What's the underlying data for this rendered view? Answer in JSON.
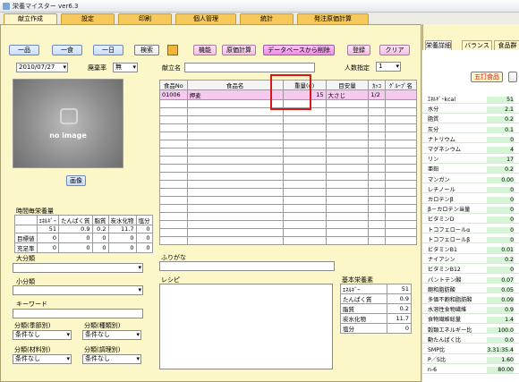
{
  "window": {
    "title": "栄養マイスター ver6.3"
  },
  "main_tabs": [
    "献立作成",
    "設定",
    "印刷",
    "個人管理",
    "統計",
    "発注原価計算"
  ],
  "meal_buttons": [
    "一品",
    "一食",
    "一日"
  ],
  "search_label": "検索",
  "toolbar": {
    "label_func": "機能",
    "cost_calc": "原価計算",
    "db_delete": "データベースから削除",
    "register": "登録",
    "clear": "クリア"
  },
  "date": "2010/07/27",
  "waste_rate": {
    "label": "廃棄率",
    "value": "無"
  },
  "menu_name_label": "献立名",
  "servings": {
    "label": "人数指定",
    "value": "1"
  },
  "photo": {
    "text": "no image",
    "button": "画像"
  },
  "food_table": {
    "headers": [
      "食品No",
      "食品名",
      "重量(g)",
      "目安量",
      "ｶｯｺ",
      "ｸﾞﾙｰﾌﾟ名"
    ],
    "rows": [
      [
        "01006",
        "押麦",
        "15",
        "大さじ",
        "1/2",
        "",
        ""
      ]
    ]
  },
  "hourly": {
    "title": "時間毎栄養量",
    "headers": [
      "",
      "ｴﾈﾙｷﾞｰ",
      "たんぱく質",
      "脂質",
      "炭水化物",
      "塩分"
    ],
    "rows": [
      [
        "",
        "51",
        "0.9",
        "0.2",
        "11.7",
        "0"
      ],
      [
        "目標値",
        "0",
        "0",
        "0",
        "0",
        "0"
      ],
      [
        "充足率",
        "0",
        "0",
        "0",
        "0",
        "0"
      ]
    ]
  },
  "left_fields": {
    "daibunrui": "大分類",
    "shobunrui": "小分類",
    "keyword": "キーワード"
  },
  "bunrui": {
    "season": {
      "label": "分類(季節別)",
      "value": "条件なし"
    },
    "kind": {
      "label": "分類(種類別)",
      "value": "条件なし"
    },
    "material": {
      "label": "分類(材料別)",
      "value": "条件なし"
    },
    "method": {
      "label": "分類(調理別)",
      "value": "条件なし"
    }
  },
  "furigana_label": "ふりがな",
  "recipe_label": "レシピ",
  "basic_nutrients": {
    "title": "基本栄養素",
    "items": [
      [
        "ｴﾈﾙｷﾞｰ",
        "51"
      ],
      [
        "たんぱく質",
        "0.9"
      ],
      [
        "脂質",
        "0.2"
      ],
      [
        "炭水化物",
        "11.7"
      ],
      [
        "塩分",
        "0"
      ]
    ]
  },
  "nutri_tabs": [
    "栄養詳細",
    "バランス",
    "食品群"
  ],
  "five_foods": "五訂食品",
  "nutrients": [
    [
      "ｴﾈﾙｷﾞｰkcal",
      "51"
    ],
    [
      "水分",
      "2.1"
    ],
    [
      "脂質",
      "0.2"
    ],
    [
      "灰分",
      "0.1"
    ],
    [
      "ナトリウム",
      "0"
    ],
    [
      "マグネシウム",
      "4"
    ],
    [
      "リン",
      "17"
    ],
    [
      "亜鉛",
      "0.2"
    ],
    [
      "マンガン",
      "0.00"
    ],
    [
      "レチノール",
      "0"
    ],
    [
      "カロテンβ",
      "0"
    ],
    [
      "β－カロテン当量",
      "0"
    ],
    [
      "ビタミンD",
      "0"
    ],
    [
      "トコフェロールα",
      "0"
    ],
    [
      "トコフェロールβ",
      "0"
    ],
    [
      "ビタミンB1",
      "0.01"
    ],
    [
      "ナイアシン",
      "0.2"
    ],
    [
      "ビタミンB12",
      "0"
    ],
    [
      "パントテン酸",
      "0.07"
    ],
    [
      "飽和脂肪酸",
      "0.05"
    ],
    [
      "多価不飽和脂肪酸",
      "0.09"
    ],
    [
      "水溶性食物繊維",
      "0.9"
    ],
    [
      "食物繊維総量",
      "1.4"
    ],
    [
      "穀類エネルギー比",
      "100.0"
    ],
    [
      "動たんぱく比",
      "0.0"
    ],
    [
      "SMP比",
      "3.31:35.4"
    ],
    [
      "P／S比",
      "1.60"
    ],
    [
      "n-6",
      "80.00"
    ]
  ]
}
